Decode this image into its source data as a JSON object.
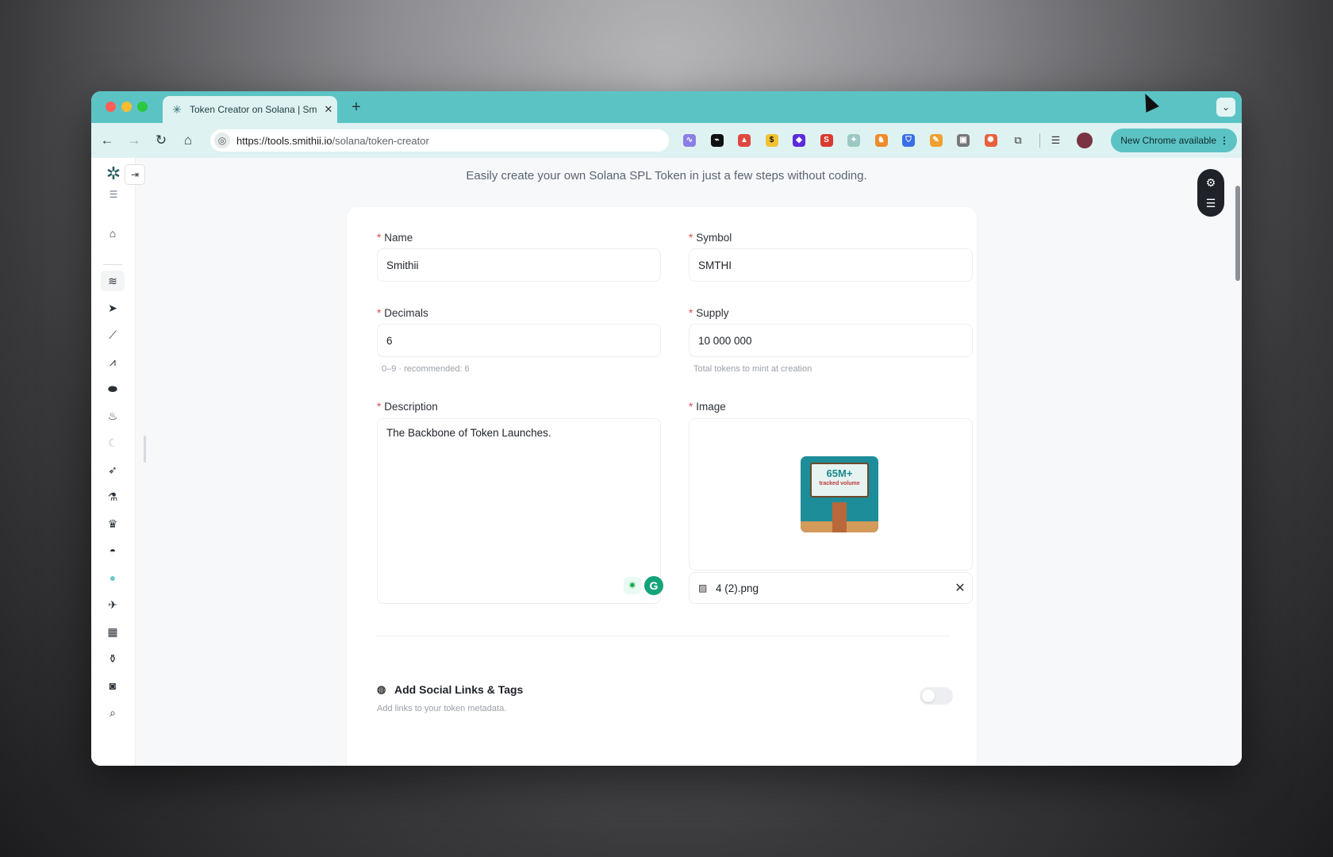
{
  "browser": {
    "tab_title": "Token Creator on Solana | Sm",
    "tab_close": "✕",
    "new_tab": "+",
    "url_domain": "https://tools.smithii.io",
    "url_path": "/solana/token-creator",
    "update_label": "New Chrome available"
  },
  "page": {
    "subtitle": "Easily create your own Solana SPL Token in just a few steps without coding."
  },
  "form": {
    "name_label": "Name",
    "name_value": "Smithii",
    "symbol_label": "Symbol",
    "symbol_value": "SMTHI",
    "decimals_label": "Decimals",
    "decimals_value": "6",
    "decimals_hint": "0–9 · recommended: 6",
    "supply_label": "Supply",
    "supply_value": "10 000 000",
    "supply_hint": "Total tokens to mint at creation",
    "description_label": "Description",
    "description_value": "The Backbone of Token Launches.",
    "image_label": "Image",
    "image_thumb_big": "65M+",
    "image_thumb_small": "tracked volume",
    "image_filename": "4 (2).png",
    "required_mark": "*"
  },
  "social": {
    "title": "Add Social Links & Tags",
    "subtitle": "Add links to your token metadata."
  },
  "icons": {
    "sidebar": [
      "home-icon",
      "database-icon",
      "send-icon",
      "chart-line-icon",
      "chart-area-icon",
      "pill-icon",
      "fire-icon",
      "moon-icon",
      "rocket-icon",
      "flask-icon",
      "crown-icon",
      "mask-icon",
      "sphere-icon",
      "rocket-launch-icon",
      "calendar-icon",
      "bottle-icon",
      "camera-icon",
      "search-icon"
    ]
  }
}
